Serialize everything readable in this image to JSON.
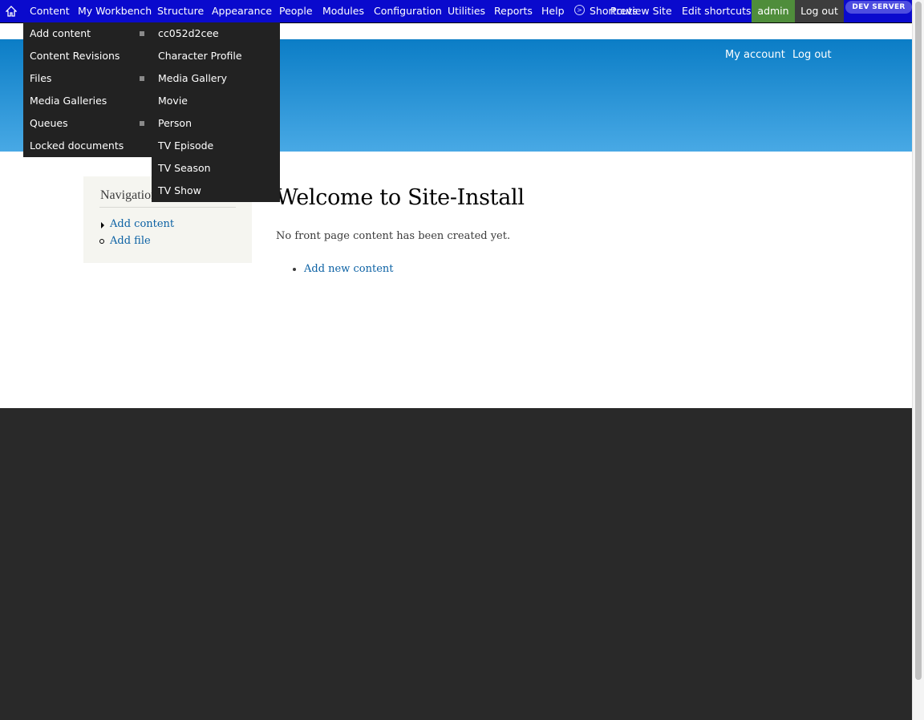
{
  "toolbar": {
    "items": [
      "Content",
      "My Workbench",
      "Structure",
      "Appearance",
      "People",
      "Modules",
      "Configuration",
      "Utilities",
      "Reports",
      "Help"
    ],
    "shortcuts_label": "Shortcuts",
    "preview_label": "Preview Site",
    "edit_shortcuts_label": "Edit shortcuts",
    "admin_label": "admin",
    "logout_label": "Log out",
    "dev_badge": "DEV SERVER"
  },
  "header": {
    "my_account": "My account",
    "log_out": "Log out"
  },
  "content_menu": {
    "items": [
      "Add content",
      "Content Revisions",
      "Files",
      "Media Galleries",
      "Queues",
      "Locked documents"
    ]
  },
  "add_content_menu": {
    "items": [
      "cc052d2cee",
      "Character Profile",
      "Media Gallery",
      "Movie",
      "Person",
      "TV Episode",
      "TV Season",
      "TV Show"
    ]
  },
  "navigation": {
    "title": "Navigation",
    "links": [
      "Add content",
      "Add file"
    ]
  },
  "main": {
    "title": "Welcome to Site-Install",
    "intro": "No front page content has been created yet.",
    "add_new_link": "Add new content"
  },
  "colors": {
    "toolbar_bg": "#0a0acd",
    "header_top": "#0b7dc6",
    "header_bottom": "#48a9e5",
    "admin_green": "#4f8d3b",
    "menu_bg": "#222222",
    "footer_bg": "#292929",
    "link": "#0b61a4"
  }
}
